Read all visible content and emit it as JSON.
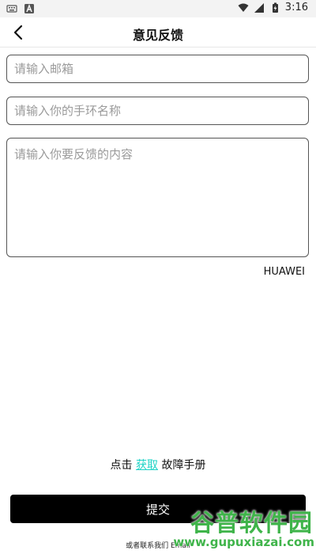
{
  "status_bar": {
    "time": "3:16"
  },
  "header": {
    "title": "意见反馈"
  },
  "form": {
    "email_placeholder": "请输入邮箱",
    "band_placeholder": "请输入你的手环名称",
    "content_placeholder": "请输入你要反馈的内容"
  },
  "device_name": "HUAWEI",
  "manual": {
    "prefix": "点击",
    "link": "获取",
    "suffix": "故障手册"
  },
  "submit_label": "提交",
  "contact_text": "或者联系我们 Email",
  "watermark": {
    "title": "谷普软件园",
    "url": "www.gupuxiazai.com"
  },
  "colors": {
    "link": "#1dd3c6",
    "button_bg": "#000000",
    "watermark": "#3fb44a"
  }
}
